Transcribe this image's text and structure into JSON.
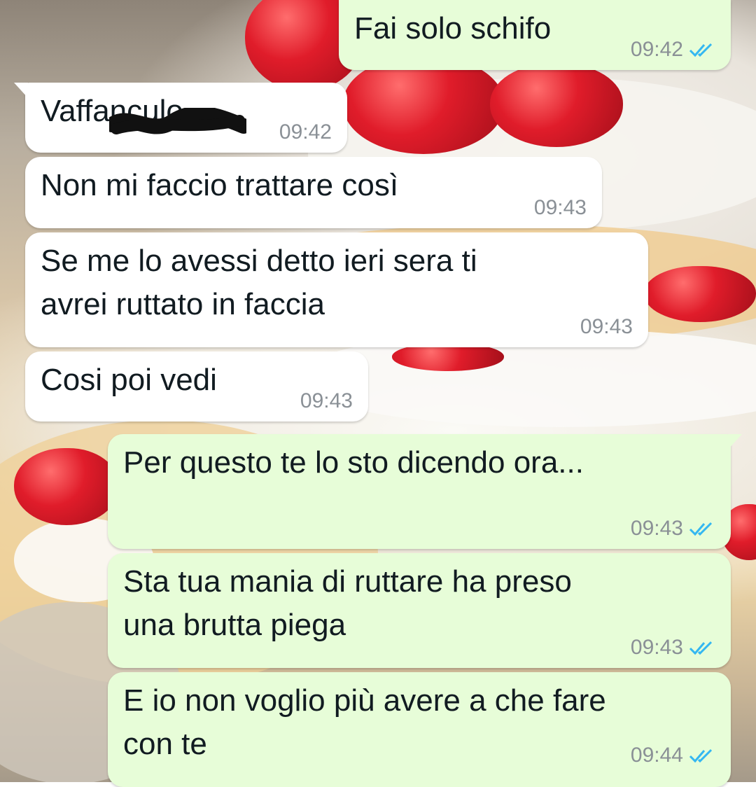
{
  "wallpaper": {
    "description_icon": "strawberry-cake-wallpaper"
  },
  "colors": {
    "incoming_bubble": "#ffffff",
    "outgoing_bubble": "#e7fdd8",
    "timestamp": "#8a9096",
    "read_ticks": "#34b7f1"
  },
  "messages": [
    {
      "direction": "out",
      "text": "Fai solo schifo",
      "time": "09:42",
      "status": "read"
    },
    {
      "direction": "in",
      "text": "Vaffanculo",
      "time": "09:42",
      "note_icon": "redaction-scribble-icon"
    },
    {
      "direction": "in",
      "text": "Non mi faccio trattare così",
      "time": "09:43"
    },
    {
      "direction": "in",
      "text": "Se me lo avessi detto ieri sera ti\navrei ruttato in faccia",
      "time": "09:43"
    },
    {
      "direction": "in",
      "text": "Cosi poi vedi",
      "time": "09:43"
    },
    {
      "direction": "out",
      "text": "Per questo te lo sto dicendo ora...",
      "time": "09:43",
      "status": "read"
    },
    {
      "direction": "out",
      "text": "Sta tua mania di ruttare ha preso\nuna brutta piega",
      "time": "09:43",
      "status": "read"
    },
    {
      "direction": "out",
      "text": "E io non voglio più avere a che fare\ncon te",
      "time": "09:44",
      "status": "read"
    }
  ]
}
